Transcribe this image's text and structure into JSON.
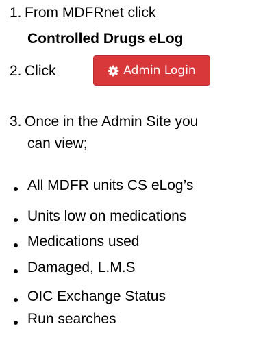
{
  "steps": {
    "step1": {
      "number": "1.",
      "text": "From MDFRnet click",
      "bold_text": "Controlled Drugs eLog"
    },
    "step2": {
      "number": "2.",
      "text": "Click"
    },
    "admin_button": {
      "label": "Admin Login",
      "icon": "gear-icon",
      "background_color": "#d9383b",
      "text_color": "#ffffff"
    },
    "step3": {
      "number": "3.",
      "text": "Once in the Admin Site you",
      "text_continued": "can view;"
    }
  },
  "bullets": [
    "All MDFR units CS eLog’s",
    "Units low on medications",
    "Medications used",
    "Damaged, L.M.S",
    "OIC Exchange Status",
    "Run searches"
  ]
}
